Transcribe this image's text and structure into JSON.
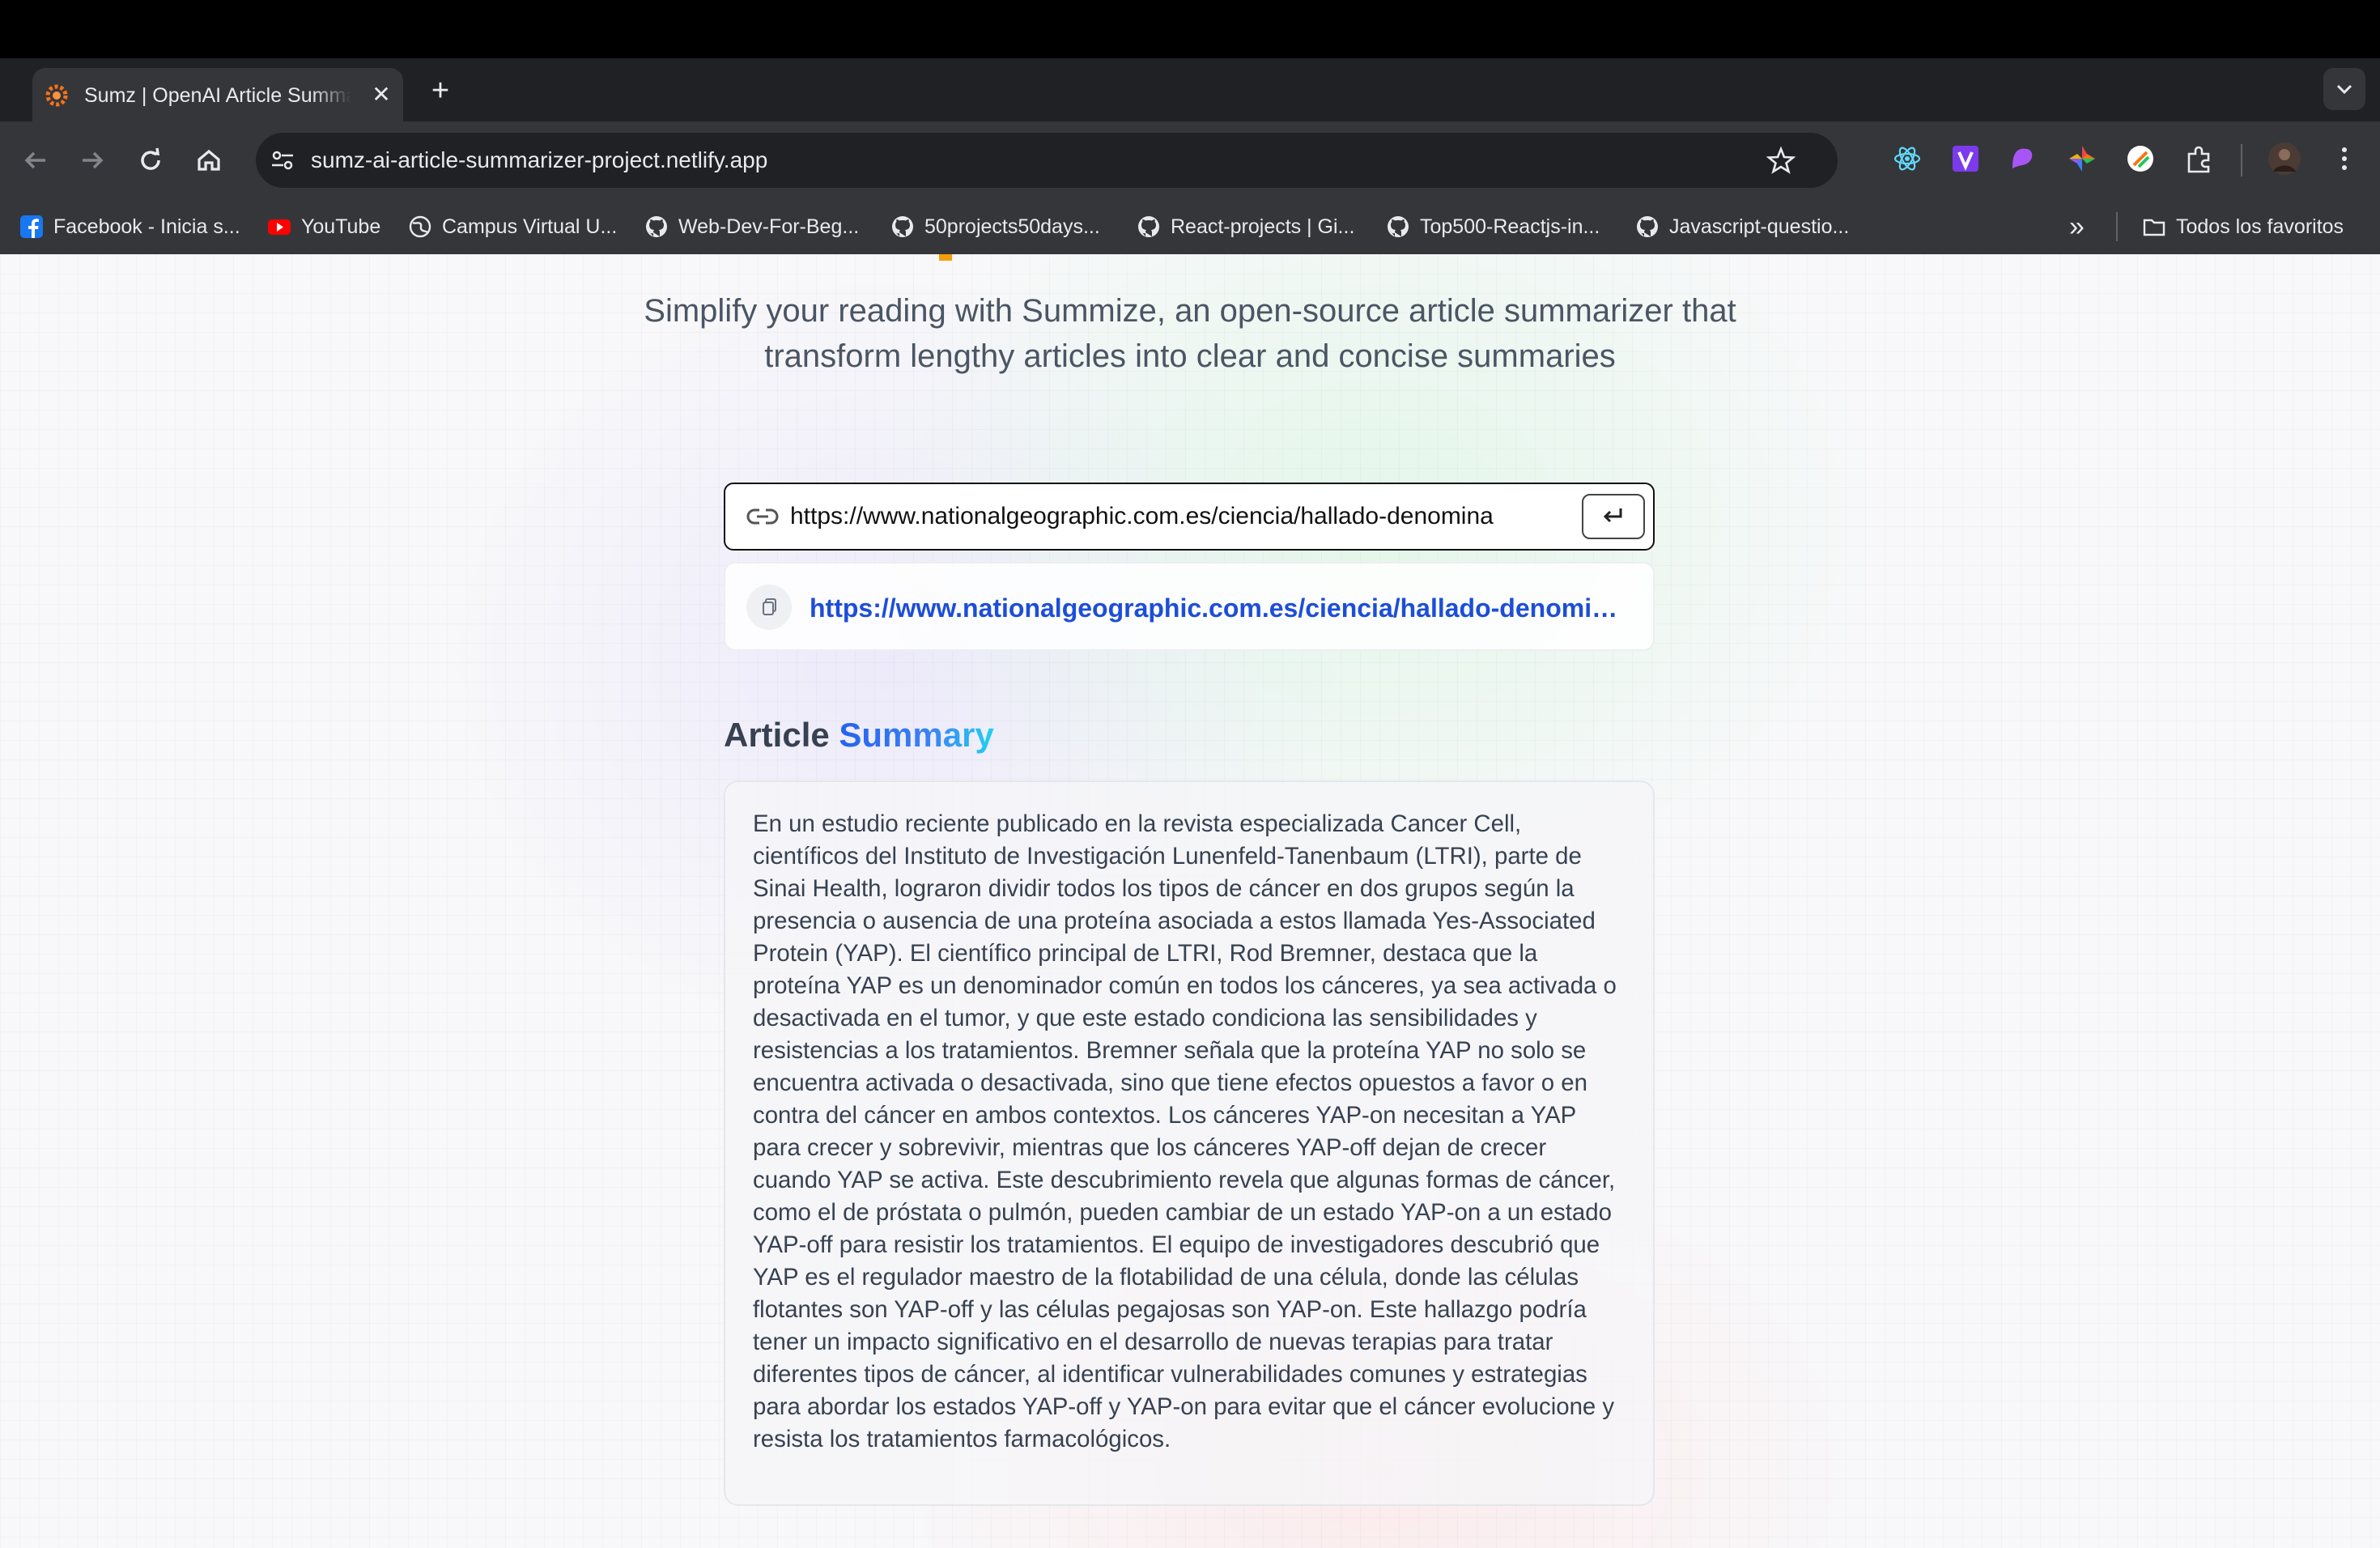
{
  "browser": {
    "tab": {
      "title": "Sumz | OpenAI Article Summarizer",
      "close_glyph": "✕"
    },
    "new_tab_glyph": "+",
    "address_bar": {
      "url": "sumz-ai-article-summarizer-project.netlify.app"
    },
    "bookmarks": [
      {
        "label": "Facebook - Inicia s...",
        "icon": "facebook-icon",
        "color": "#1877f2"
      },
      {
        "label": "YouTube",
        "icon": "youtube-icon",
        "color": "#ff0000"
      },
      {
        "label": "Campus Virtual U...",
        "icon": "globe-icon",
        "color": "#e8eaed"
      },
      {
        "label": "Web-Dev-For-Beg...",
        "icon": "github-icon",
        "color": "#e8eaed"
      },
      {
        "label": "50projects50days...",
        "icon": "github-icon",
        "color": "#e8eaed"
      },
      {
        "label": "React-projects | Gi...",
        "icon": "github-icon",
        "color": "#e8eaed"
      },
      {
        "label": "Top500-Reactjs-in...",
        "icon": "github-icon",
        "color": "#e8eaed"
      },
      {
        "label": "Javascript-questio...",
        "icon": "github-icon",
        "color": "#e8eaed"
      }
    ],
    "all_bookmarks_label": "Todos los favoritos",
    "overflow_glyph": "»"
  },
  "page": {
    "tagline": "Simplify your reading with Summize, an open-source article summarizer that transform lengthy articles into clear and concise summaries",
    "form": {
      "input_value": "https://www.nationalgeographic.com.es/ciencia/hallado-denominador-comun",
      "submit_glyph": "↵"
    },
    "history": [
      {
        "url": "https://www.nationalgeographic.com.es/ciencia/hallado-denominador-comun"
      }
    ],
    "summary": {
      "heading_prefix": "Article",
      "heading_accent": "Summary",
      "text": "En un estudio reciente publicado en la revista especializada Cancer Cell, científicos del Instituto de Investigación Lunenfeld-Tanenbaum (LTRI), parte de Sinai Health, lograron dividir todos los tipos de cáncer en dos grupos según la presencia o ausencia de una proteína asociada a estos llamada Yes-Associated Protein (YAP). El científico principal de LTRI, Rod Bremner, destaca que la proteína YAP es un denominador común en todos los cánceres, ya sea activada o desactivada en el tumor, y que este estado condiciona las sensibilidades y resistencias a los tratamientos. Bremner señala que la proteína YAP no solo se encuentra activada o desactivada, sino que tiene efectos opuestos a favor o en contra del cáncer en ambos contextos. Los cánceres YAP-on necesitan a YAP para crecer y sobrevivir, mientras que los cánceres YAP-off dejan de crecer cuando YAP se activa. Este descubrimiento revela que algunas formas de cáncer, como el de próstata o pulmón, pueden cambiar de un estado YAP-on a un estado YAP-off para resistir los tratamientos. El equipo de investigadores descubrió que YAP es el regulador maestro de la flotabilidad de una célula, donde las células flotantes son YAP-off y las células pegajosas son YAP-on. Este hallazgo podría tener un impacto significativo en el desarrollo de nuevas terapias para tratar diferentes tipos de cáncer, al identificar vulnerabilidades comunes y estrategias para abordar los estados YAP-off y YAP-on para evitar que el cáncer evolucione y resista los tratamientos farmacológicos."
    }
  },
  "colors": {
    "accent_blue": "#1d4ed8",
    "tagline_gray": "#4b5563",
    "accent_orange": "#f59e0b"
  }
}
